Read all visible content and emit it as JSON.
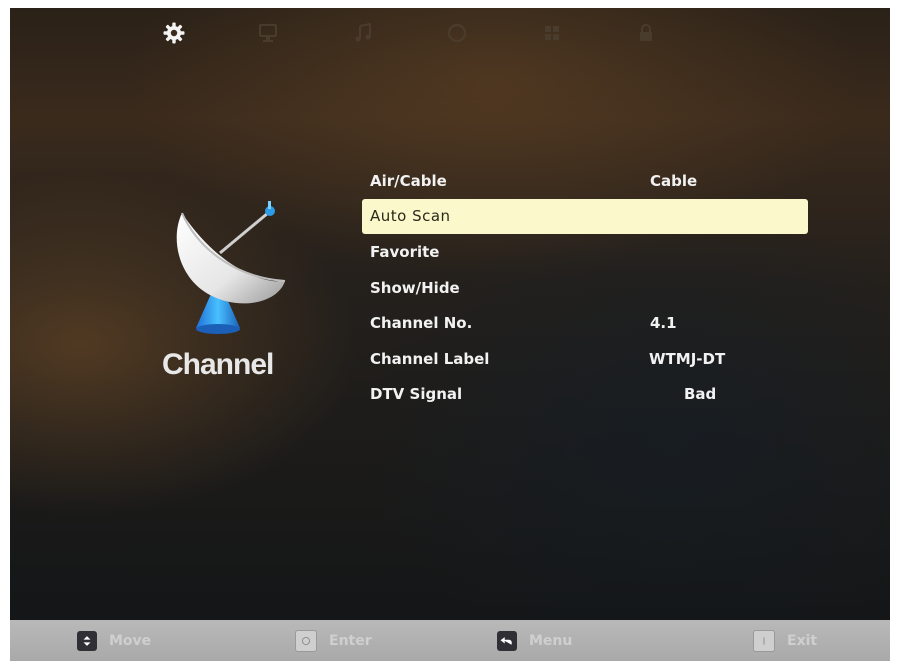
{
  "tabs": [
    {
      "icon": "gear-icon",
      "active": true
    },
    {
      "icon": "monitor-icon",
      "active": false
    },
    {
      "icon": "music-note-icon",
      "active": false
    },
    {
      "icon": "circle-icon",
      "active": false
    },
    {
      "icon": "grid-icon",
      "active": false
    },
    {
      "icon": "lock-icon",
      "active": false
    }
  ],
  "section": {
    "title": "Channel",
    "icon": "satellite-dish-icon"
  },
  "menu": {
    "items": [
      {
        "label": "Air/Cable",
        "value": "Cable"
      },
      {
        "label": "Auto Scan",
        "value": "",
        "selected": true
      },
      {
        "label": "Favorite",
        "value": ""
      },
      {
        "label": "Show/Hide",
        "value": ""
      },
      {
        "label": "Channel No.",
        "value": "4.1"
      },
      {
        "label": "Channel Label",
        "value": "WTMJ-DT"
      },
      {
        "label": "DTV Signal",
        "value": "Bad"
      }
    ]
  },
  "footer": {
    "hints": [
      {
        "key_icon": "updown-arrows-icon",
        "label": "Move"
      },
      {
        "key_icon": "enter-icon",
        "label": "Enter"
      },
      {
        "key_icon": "return-arrow-icon",
        "label": "Menu"
      },
      {
        "key_icon": "exit-icon",
        "label": "Exit"
      }
    ]
  },
  "colors": {
    "highlight_bg": "#fbf8cc",
    "text": "#f2f2f2",
    "footer_bg": "#b0b0b0"
  }
}
